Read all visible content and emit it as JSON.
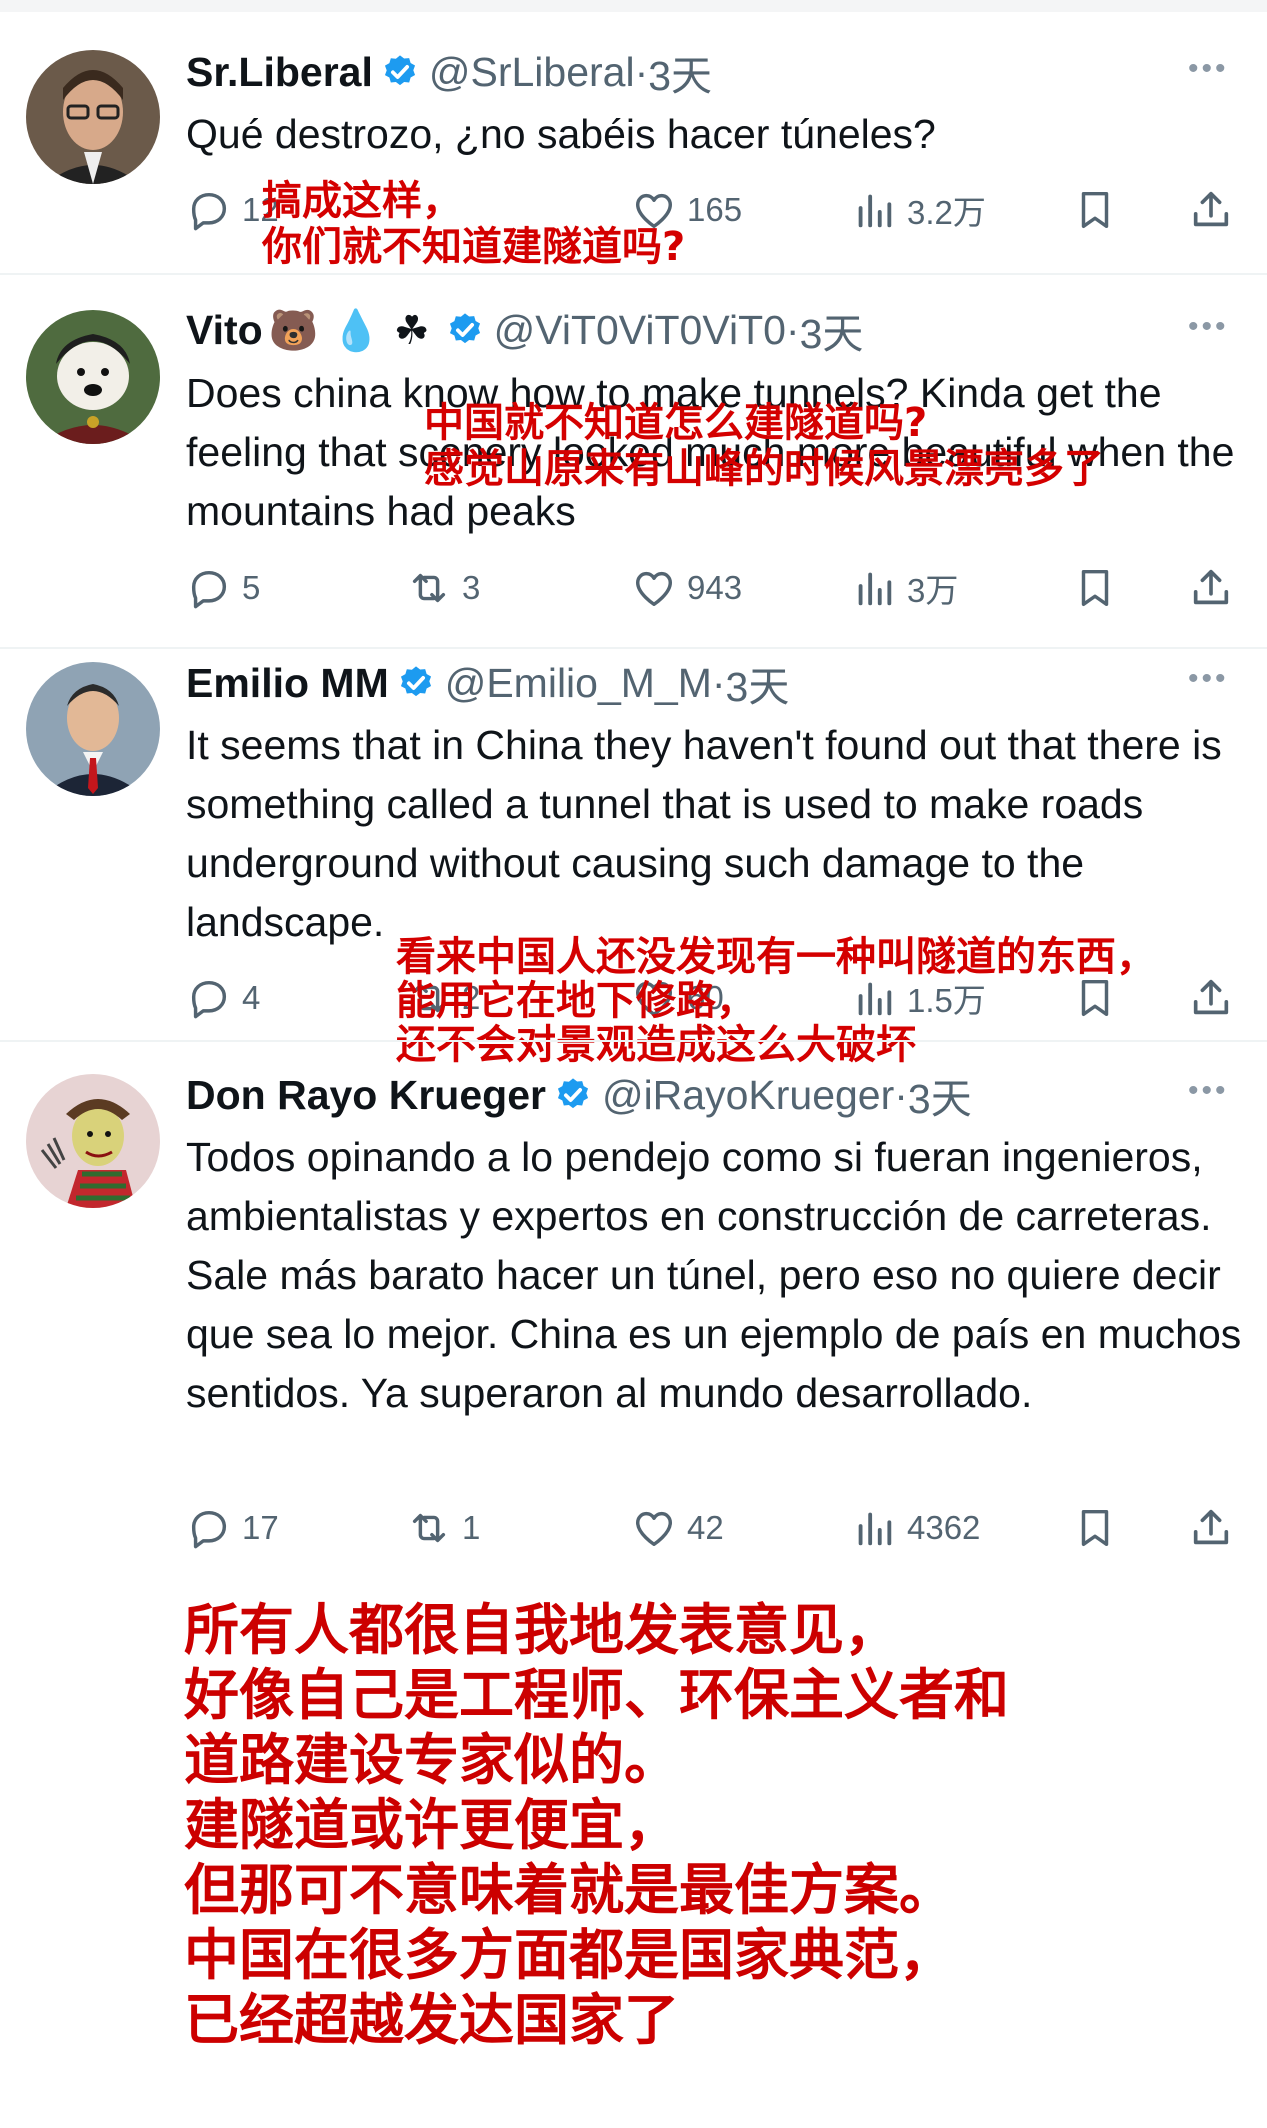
{
  "tweets": [
    {
      "name": "Sr.Liberal",
      "handle": "@SrLiberal",
      "time": "3天",
      "emoji": "",
      "text": "Qué destrozo, ¿no sabéis hacer túneles?",
      "replies": "12",
      "retweets": "",
      "likes": "165",
      "views": "3.2万",
      "annotation": "搞成这样，\n你们就不知道建隧道吗?"
    },
    {
      "name": "Vito",
      "handle": "@ViT0ViT0ViT0",
      "time": "3天",
      "emoji": "🐻 💧 ☘",
      "text": "Does china know how to make tunnels? Kinda get the feeling that scenery looked much more beautiful when the mountains had peaks",
      "replies": "5",
      "retweets": "3",
      "likes": "943",
      "views": "3万",
      "annotation": "中国就不知道怎么建隧道吗?\n感觉山原来有山峰的时候风景漂亮多了"
    },
    {
      "name": "Emilio MM",
      "handle": "@Emilio_M_M",
      "time": "3天",
      "emoji": "",
      "text": "It seems that in China they haven't found out that there is something called a tunnel that is used to make roads underground without causing such damage to the landscape.",
      "replies": "4",
      "retweets": "2",
      "likes": "60",
      "views": "1.5万",
      "annotation": "看来中国人还没发现有一种叫隧道的东西，\n能用它在地下修路，\n还不会对景观造成这么大破坏"
    },
    {
      "name": "Don Rayo Krueger",
      "handle": "@iRayoKrueger",
      "time": "3天",
      "emoji": "",
      "text": "Todos opinando a lo pendejo como si fueran ingenieros, ambientalistas y expertos en construcción de carreteras. Sale más barato hacer un túnel, pero eso no quiere decir que sea lo mejor. China es un ejemplo de país en muchos sentidos. Ya superaron al mundo desarrollado.",
      "replies": "17",
      "retweets": "1",
      "likes": "42",
      "views": "4362",
      "annotation": "所有人都很自我地发表意见，\n好像自己是工程师、环保主义者和\n道路建设专家似的。\n建隧道或许更便宜，\n但那可不意味着就是最佳方案。\n中国在很多方面都是国家典范，\n已经超越发达国家了"
    }
  ],
  "colors": {
    "verified": "#1d9bf0",
    "annotation": "#d40000",
    "meta": "#536471"
  },
  "icons": [
    "reply-icon",
    "retweet-icon",
    "like-icon",
    "views-icon",
    "bookmark-icon",
    "share-icon",
    "verified-icon",
    "more-icon"
  ]
}
